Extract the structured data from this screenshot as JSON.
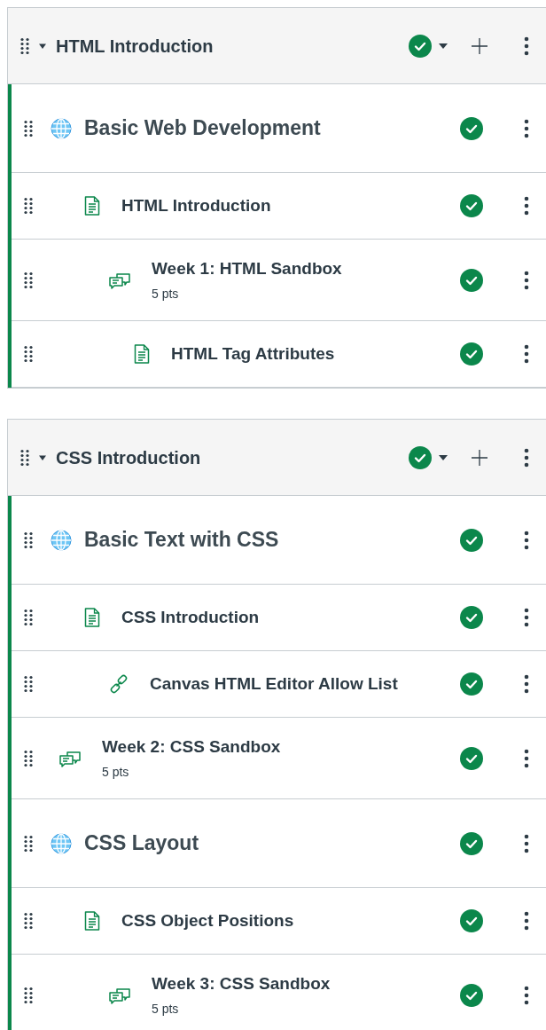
{
  "modules": [
    {
      "title": "HTML Introduction",
      "published": true,
      "expanded": true,
      "items": [
        {
          "kind": "heading",
          "title": "Basic Web Development",
          "published": true,
          "children": [
            {
              "kind": "page",
              "title": "HTML Introduction",
              "published": true,
              "children": [
                {
                  "kind": "discussion",
                  "title": "Week 1: HTML Sandbox",
                  "points": "5 pts",
                  "published": true,
                  "children": [
                    {
                      "kind": "page",
                      "title": "HTML Tag Attributes",
                      "published": true
                    }
                  ]
                }
              ]
            }
          ]
        }
      ]
    },
    {
      "title": "CSS Introduction",
      "published": true,
      "expanded": true,
      "items": [
        {
          "kind": "heading",
          "title": "Basic Text with CSS",
          "published": true,
          "children": [
            {
              "kind": "page",
              "title": "CSS Introduction",
              "published": true,
              "children": [
                {
                  "kind": "link",
                  "title": "Canvas HTML Editor Allow List",
                  "published": true
                }
              ]
            }
          ]
        },
        {
          "kind": "discussion",
          "title": "Week 2: CSS Sandbox",
          "points": "5 pts",
          "published": true
        },
        {
          "kind": "heading",
          "title": "CSS Layout",
          "published": true,
          "children": [
            {
              "kind": "page",
              "title": "CSS Object Positions",
              "published": true,
              "children": [
                {
                  "kind": "discussion",
                  "title": "Week 3: CSS Sandbox",
                  "points": "5 pts",
                  "published": true
                }
              ]
            }
          ]
        }
      ]
    }
  ]
}
